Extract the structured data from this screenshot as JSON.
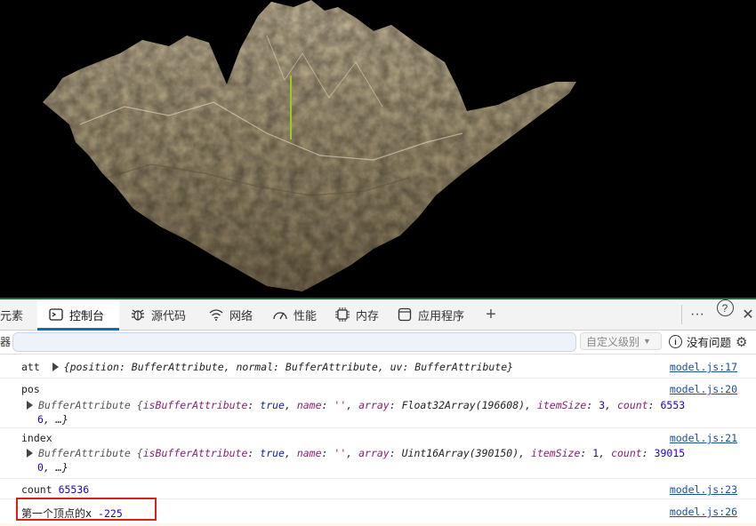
{
  "devtools": {
    "tabs": [
      {
        "label": "元素",
        "icon": "elements-icon"
      },
      {
        "label": "控制台",
        "icon": "console-icon"
      },
      {
        "label": "源代码",
        "icon": "bug-icon"
      },
      {
        "label": "网络",
        "icon": "wifi-icon"
      },
      {
        "label": "性能",
        "icon": "gauge-icon"
      },
      {
        "label": "内存",
        "icon": "chip-icon"
      },
      {
        "label": "应用程序",
        "icon": "app-icon"
      }
    ],
    "add_tab": "+",
    "more": "···",
    "help": "?",
    "close": "✕",
    "filter_label": "器",
    "filter_placeholder": "",
    "level_label": "自定义级别",
    "issues_label": "没有问题"
  },
  "console": {
    "logs": [
      {
        "label": "att",
        "value": "{position: BufferAttribute, normal: BufferAttribute, uv: BufferAttribute}",
        "source": "model.js:17"
      },
      {
        "label": "pos",
        "line1_prefix": "BufferAttribute {",
        "isBA": "isBufferAttribute",
        "true1": "true",
        "name_k": "name",
        "name_v": "''",
        "array_k": "array",
        "array_v": "Float32Array(196608)",
        "itemSize_k": "itemSize",
        "itemSize_v": "3",
        "count_k": "count",
        "count_v1": "6553",
        "count_v2": "6",
        "ellipsis": ", …}",
        "source": "model.js:20"
      },
      {
        "label": "index",
        "line1_prefix": "BufferAttribute {",
        "isBA": "isBufferAttribute",
        "true1": "true",
        "name_k": "name",
        "name_v": "''",
        "array_k": "array",
        "array_v": "Uint16Array(390150)",
        "itemSize_k": "itemSize",
        "itemSize_v": "1",
        "count_k": "count",
        "count_v1": "39015",
        "count_v2": "0",
        "ellipsis": ", …}",
        "source": "model.js:21"
      },
      {
        "label": "count",
        "value": "65536",
        "source": "model.js:23"
      },
      {
        "label": "第一个顶点的x",
        "value": "-225",
        "source": "model.js:26"
      }
    ]
  },
  "colors": {
    "terrain": "#b8ab8c",
    "highlight_box": "#d9201f",
    "axis_line": "#9acd1a",
    "link": "#1a4f9c"
  }
}
